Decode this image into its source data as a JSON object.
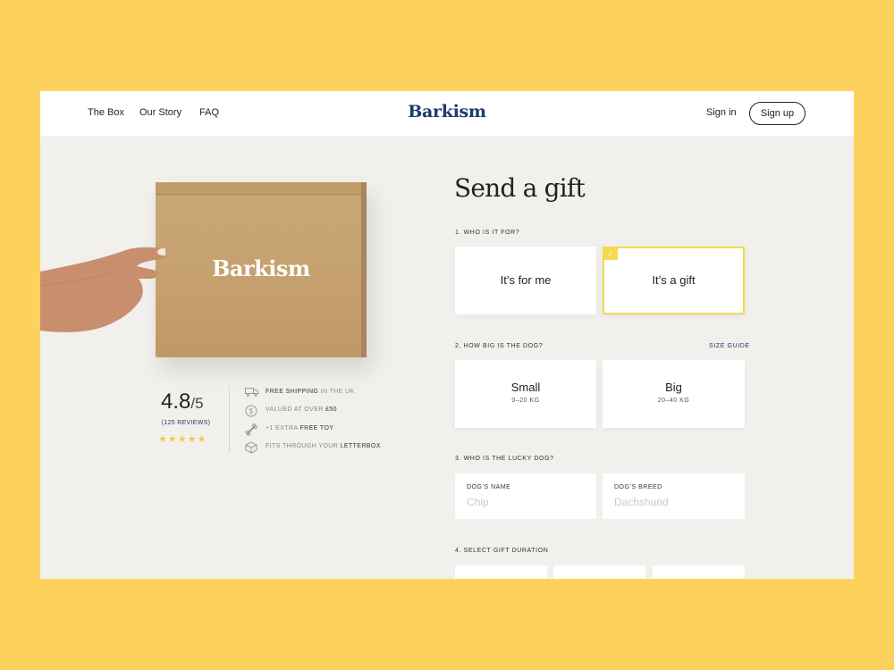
{
  "nav": {
    "links": [
      "The Box",
      "Our Story",
      "FAQ"
    ],
    "brand": "Barkism",
    "signin": "Sign in",
    "signup": "Sign up"
  },
  "product": {
    "box_logo": "Barkism",
    "rating": "4.8",
    "rating_max": "/5",
    "reviews": "(125 REVIEWS)",
    "stars": "★★★★★",
    "perks": [
      {
        "icon": "truck-icon",
        "strong": "FREE SHIPPING",
        "rest": " IN THE UK",
        "order": "strong-first"
      },
      {
        "icon": "coin-icon",
        "strong": "£50",
        "rest": "VALUED AT OVER ",
        "order": "rest-first"
      },
      {
        "icon": "bone-icon",
        "strong": "FREE TOY",
        "rest": "+1 EXTRA ",
        "order": "rest-first"
      },
      {
        "icon": "box-icon",
        "strong": "LETTERBOX",
        "rest": "FITS THROUGH YOUR ",
        "order": "rest-first"
      }
    ]
  },
  "form": {
    "title": "Send a gift",
    "q1": "1. WHO IS IT FOR?",
    "q1_options": [
      "It’s for me",
      "It’s a gift"
    ],
    "q2": "2. HOW BIG IS THE DOG?",
    "size_guide": "SIZE GUIDE",
    "q2_options": [
      {
        "label": "Small",
        "sub": "0–20 KG"
      },
      {
        "label": "Big",
        "sub": "20–40 KG"
      }
    ],
    "q3": "3. WHO IS THE LUCKY DOG?",
    "name_label": "DOG’S NAME",
    "name_placeholder": "Chip",
    "breed_label": "DOG’S BREED",
    "breed_placeholder": "Dachshund",
    "q4": "4. SELECT GIFT DURATION"
  },
  "colors": {
    "background": "#FDD25C",
    "brand": "#1B3A6B",
    "accent": "#F4DA4E"
  }
}
